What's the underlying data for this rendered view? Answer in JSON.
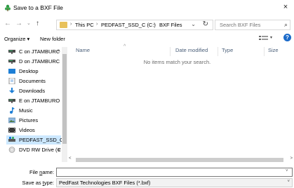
{
  "window": {
    "title": "Save to a BXF File",
    "close_glyph": "×"
  },
  "nav": {
    "back_glyph": "←",
    "forward_glyph": "→",
    "recent_glyph": "⌄",
    "up_glyph": "↑",
    "address_crumbs": [
      "This PC",
      "PEDFAST_SSD_C (C:)",
      "BXF Files"
    ],
    "address_sep": "›",
    "address_dropdown_glyph": "⌄",
    "refresh_glyph": "↻",
    "search_placeholder": "Search BXF Files",
    "search_glyph": "⌕"
  },
  "toolbar": {
    "organize_label": "Organize ▾",
    "new_folder_label": "New folder",
    "view_dropdown_glyph": "▾",
    "help_glyph": "?"
  },
  "nav_pane": {
    "items": [
      {
        "label": "C on JTAMBURC",
        "icon": "network-drive-icon",
        "suffix": "^"
      },
      {
        "label": "D on JTAMBURC",
        "icon": "network-drive-icon",
        "suffix": ""
      },
      {
        "label": "Desktop",
        "icon": "desktop-icon",
        "suffix": ""
      },
      {
        "label": "Documents",
        "icon": "documents-icon",
        "suffix": ""
      },
      {
        "label": "Downloads",
        "icon": "downloads-icon",
        "suffix": ""
      },
      {
        "label": "E on JTAMBURO",
        "icon": "network-drive-icon",
        "suffix": ""
      },
      {
        "label": "Music",
        "icon": "music-icon",
        "suffix": ""
      },
      {
        "label": "Pictures",
        "icon": "pictures-icon",
        "suffix": ""
      },
      {
        "label": "Videos",
        "icon": "videos-icon",
        "suffix": ""
      },
      {
        "label": "PEDFAST_SSD_C",
        "icon": "local-drive-icon",
        "suffix": ""
      },
      {
        "label": "DVD RW Drive (C",
        "icon": "dvd-drive-icon",
        "suffix": "˅"
      }
    ]
  },
  "content": {
    "columns": [
      "Name",
      "Date modified",
      "Type",
      "Size"
    ],
    "sort_glyph": "^",
    "empty_message": "No items match your search."
  },
  "scroll": {
    "left_glyph": "<",
    "right_glyph": ">"
  },
  "form": {
    "file_name_label_pre": "File ",
    "file_name_label_key": "n",
    "file_name_label_post": "ame:",
    "file_name_value": "",
    "save_type_label_pre": "Save as ",
    "save_type_label_key": "t",
    "save_type_label_post": "ype:",
    "save_type_value": "PedFast Technologies BXF Files (*.bxf)",
    "dropdown_glyph": "˅"
  },
  "footer": {
    "hide_folders_label": "^  Hide Folders",
    "save_label_key": "S",
    "save_label_rest": "ave",
    "cancel_label": "Cancel"
  },
  "colors": {
    "accent": "#0078d7",
    "selection": "#cce8ff",
    "folder": "#e8c15b"
  }
}
